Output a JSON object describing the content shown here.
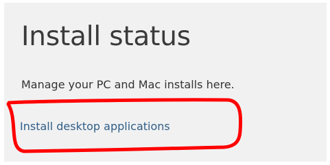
{
  "install_status": {
    "title": "Install status",
    "description": "Manage your PC and Mac installs here.",
    "link_label": "Install desktop applications"
  },
  "colors": {
    "card_background": "#f1f1f1",
    "title_text": "#3a3a3a",
    "link_text": "#2f5e88",
    "annotation": "#ff0000"
  }
}
